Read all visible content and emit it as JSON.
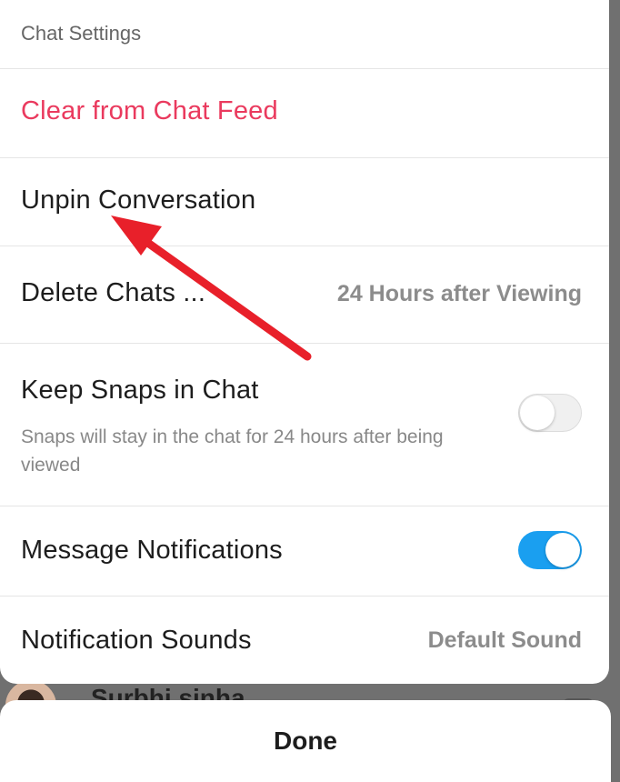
{
  "sheet": {
    "header_title": "Chat Settings",
    "clear_label": "Clear from Chat Feed",
    "unpin_label": "Unpin Conversation",
    "delete_label": "Delete Chats ...",
    "delete_value": "24 Hours after Viewing",
    "keep_label": "Keep Snaps in Chat",
    "keep_sublabel": "Snaps will stay in the chat for 24 hours after being viewed",
    "keep_toggle_on": false,
    "notifications_label": "Message Notifications",
    "notifications_toggle_on": true,
    "sounds_label": "Notification Sounds",
    "sounds_value": "Default Sound"
  },
  "background": {
    "contact_name": "Surbhi sinha"
  },
  "done_label": "Done",
  "colors": {
    "destructive": "#ea3a5e",
    "toggle_on": "#1a9ff0",
    "annotation_arrow": "#e8202a"
  },
  "icons": {
    "annotation": "red-arrow-icon"
  }
}
